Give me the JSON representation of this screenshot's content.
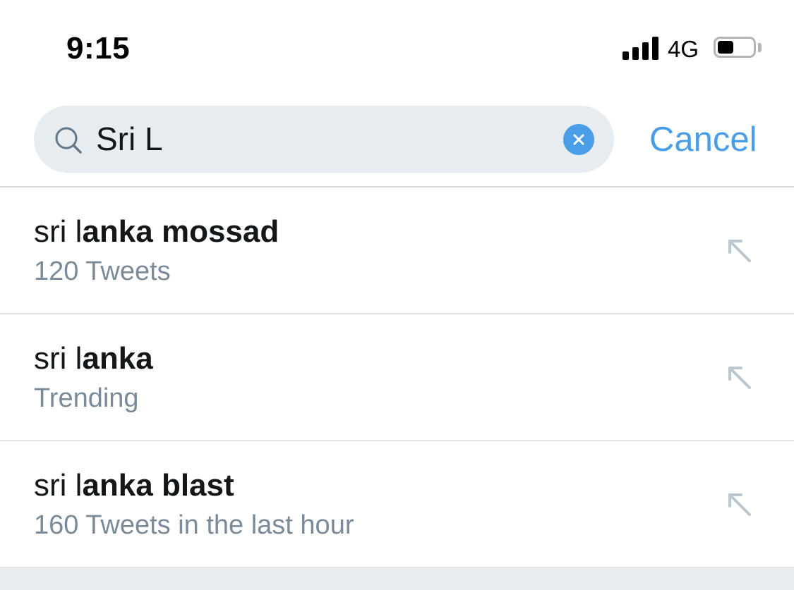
{
  "status_bar": {
    "time": "9:15",
    "network": "4G",
    "battery_level": 0.45,
    "signal_bars": 4
  },
  "search": {
    "query": "Sri L",
    "cancel_label": "Cancel",
    "icon": "search-icon",
    "clear_icon": "clear-icon"
  },
  "results": [
    {
      "typed": "sri l",
      "completion": "anka mossad",
      "meta": "120 Tweets",
      "icon": "fill-query-arrow-icon"
    },
    {
      "typed": "sri l",
      "completion": "anka",
      "meta": "Trending",
      "icon": "fill-query-arrow-icon"
    },
    {
      "typed": "sri l",
      "completion": "anka blast",
      "meta": "160 Tweets in the last hour",
      "icon": "fill-query-arrow-icon"
    }
  ],
  "colors": {
    "accent": "#4a9ee8",
    "search_bg": "#e6ecf0",
    "meta_text": "#7a8a99",
    "arrow": "#bcc6cf"
  }
}
